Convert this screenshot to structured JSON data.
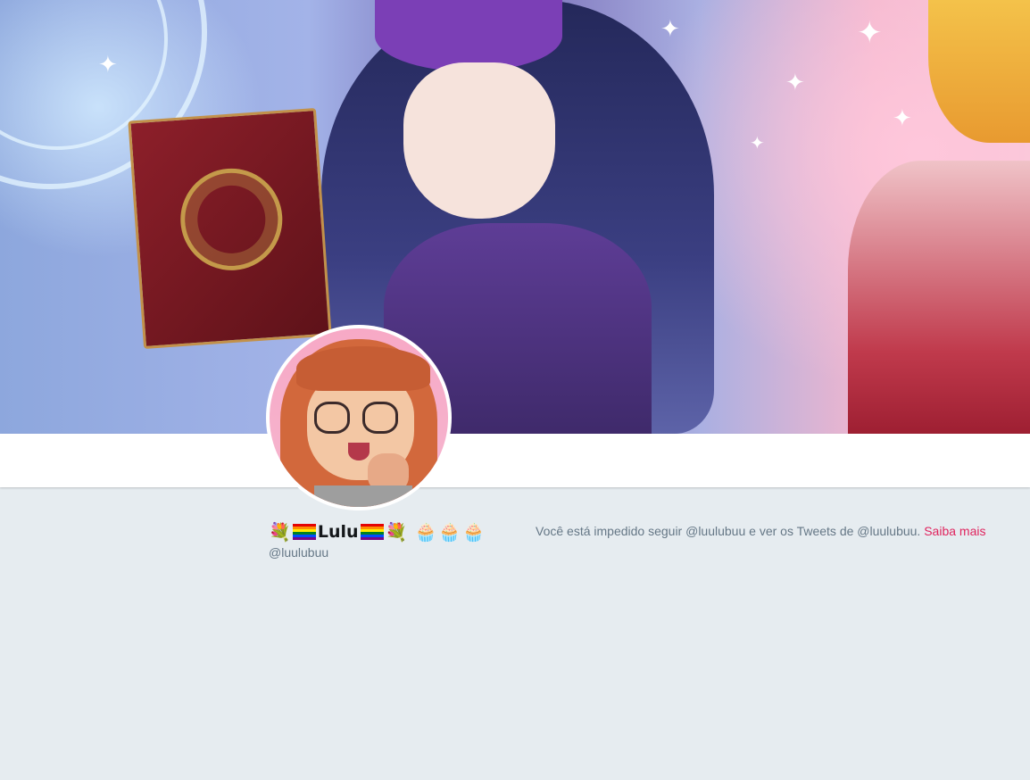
{
  "profile": {
    "display_name_prefix_emoji": "💐",
    "display_name": "Lulu",
    "display_name_suffix_emoji": "💐",
    "flag_icon": "rainbow-flag-icon",
    "cupcakes": "🧁🧁🧁",
    "handle": "@luulubuu"
  },
  "blocked_notice": {
    "text": "Você está impedido seguir @luulubuu e ver os Tweets de @luulubuu.",
    "link_label": "Saiba mais"
  },
  "colors": {
    "page_background": "#e6ecf0",
    "link": "#e0245e",
    "muted_text": "#657786"
  }
}
